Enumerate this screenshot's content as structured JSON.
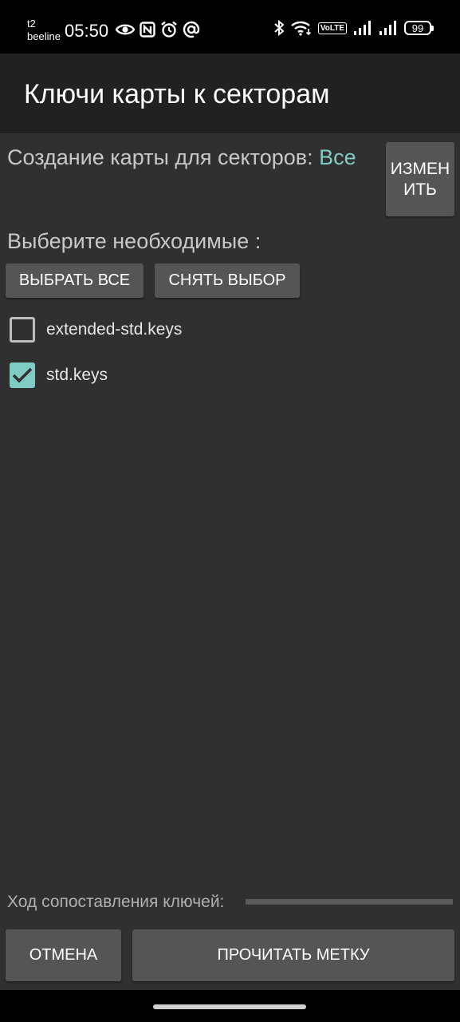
{
  "status_bar": {
    "carrier_line1": "t2",
    "carrier_line2": "beeline",
    "time": "05:50",
    "volte": "VoLTE",
    "battery": "99",
    "icons_left": [
      "eye-icon",
      "nfc-icon",
      "alarm-icon",
      "at-icon"
    ],
    "icons_right": [
      "bluetooth-icon",
      "wifi-icon",
      "volte-icon",
      "signal-icon-1",
      "signal-icon-2",
      "battery-icon"
    ]
  },
  "app_bar": {
    "title": "Ключи карты к секторам"
  },
  "map_creation": {
    "label": "Создание карты для секторов:",
    "value": "Все",
    "change_button": "ИЗМЕНИТЬ"
  },
  "selection": {
    "label": "Выберите необходимые :",
    "select_all_button": "ВЫБРАТЬ ВСЕ",
    "deselect_button": "СНЯТЬ ВЫБОР"
  },
  "key_files": [
    {
      "label": "extended-std.keys",
      "checked": false
    },
    {
      "label": "std.keys",
      "checked": true
    }
  ],
  "progress": {
    "label": "Ход сопоставления ключей:",
    "value": 0
  },
  "actions": {
    "cancel_button": "ОТМЕНА",
    "read_button": "ПРОЧИТАТЬ МЕТКУ"
  },
  "colors": {
    "accent": "#80cbc4",
    "background": "#303030",
    "app_bar": "#212121",
    "button": "#555555"
  }
}
